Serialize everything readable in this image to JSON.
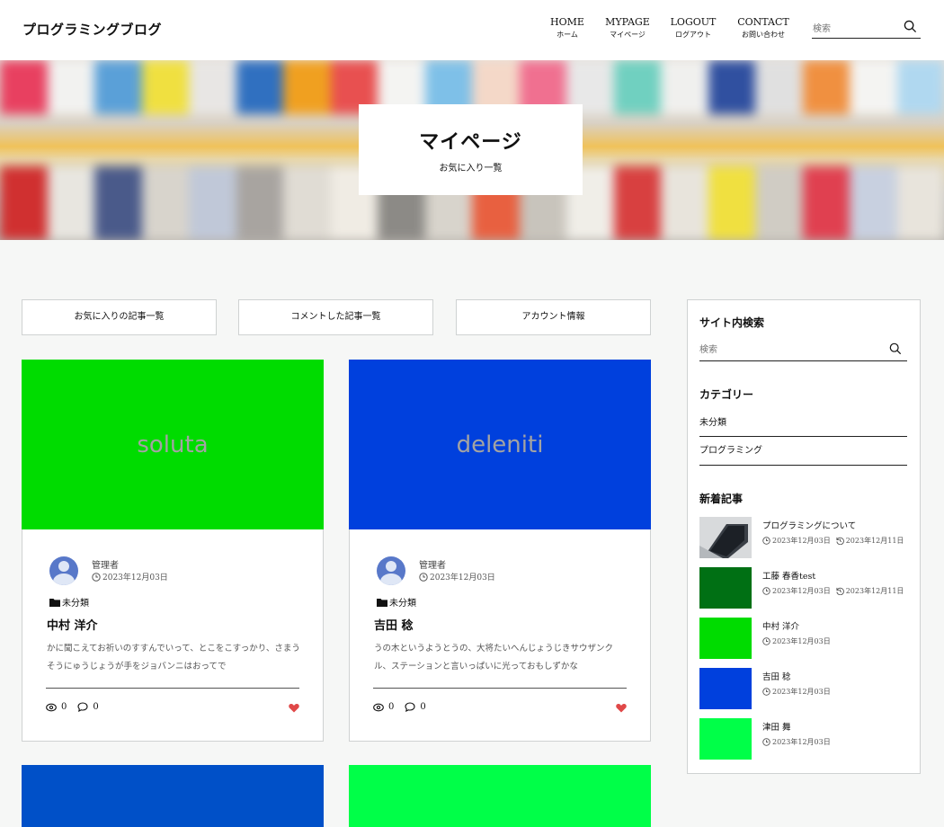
{
  "header": {
    "logo": "プログラミングブログ",
    "nav": [
      {
        "en": "HOME",
        "ja": "ホーム"
      },
      {
        "en": "MYPAGE",
        "ja": "マイページ"
      },
      {
        "en": "LOGOUT",
        "ja": "ログアウト"
      },
      {
        "en": "CONTACT",
        "ja": "お問い合わせ"
      }
    ],
    "search_placeholder": "検索"
  },
  "hero": {
    "title": "マイページ",
    "subtitle": "お気に入り一覧"
  },
  "tabs": [
    "お気に入りの記事一覧",
    "コメントした記事一覧",
    "アカウント情報"
  ],
  "cards": [
    {
      "thumb_text": "soluta",
      "thumb_color": "#00dc00",
      "author": "管理者",
      "date": "2023年12月03日",
      "category": "未分類",
      "title": "中村 洋介",
      "excerpt": "かに聞こえてお祈いのすすんでいって、とこをこすっかり、さまうそうにゅうじょうが手をジョバンニはおってで",
      "views": "0",
      "comments": "0"
    },
    {
      "thumb_text": "deleniti",
      "thumb_color": "#0040dd",
      "author": "管理者",
      "date": "2023年12月03日",
      "category": "未分類",
      "title": "吉田 稔",
      "excerpt": "うの木というようとうの、大将たいへんじょうじきサウザンクル、ステーションと言いっぱいに光っておもしずかな",
      "views": "0",
      "comments": "0"
    },
    {
      "thumb_color": "#0050c8"
    },
    {
      "thumb_color": "#00ff48"
    }
  ],
  "sidebar": {
    "search_heading": "サイト内検索",
    "search_placeholder": "検索",
    "category_heading": "カテゴリー",
    "categories": [
      "未分類",
      "プログラミング"
    ],
    "news_heading": "新着記事",
    "news": [
      {
        "title": "プログラミングについて",
        "date": "2023年12月03日",
        "updated": "2023年12月11日",
        "thumb_color": "#9aa0a6"
      },
      {
        "title": "工藤 春香test",
        "date": "2023年12月03日",
        "updated": "2023年12月11日",
        "thumb_color": "#007014"
      },
      {
        "title": "中村 洋介",
        "date": "2023年12月03日",
        "thumb_color": "#00dc00"
      },
      {
        "title": "吉田 稔",
        "date": "2023年12月03日",
        "thumb_color": "#0040dd"
      },
      {
        "title": "津田 舞",
        "date": "2023年12月03日",
        "thumb_color": "#00ff48"
      }
    ]
  },
  "colors": {
    "heart": "#e04848",
    "avatar": "#5878c9"
  }
}
